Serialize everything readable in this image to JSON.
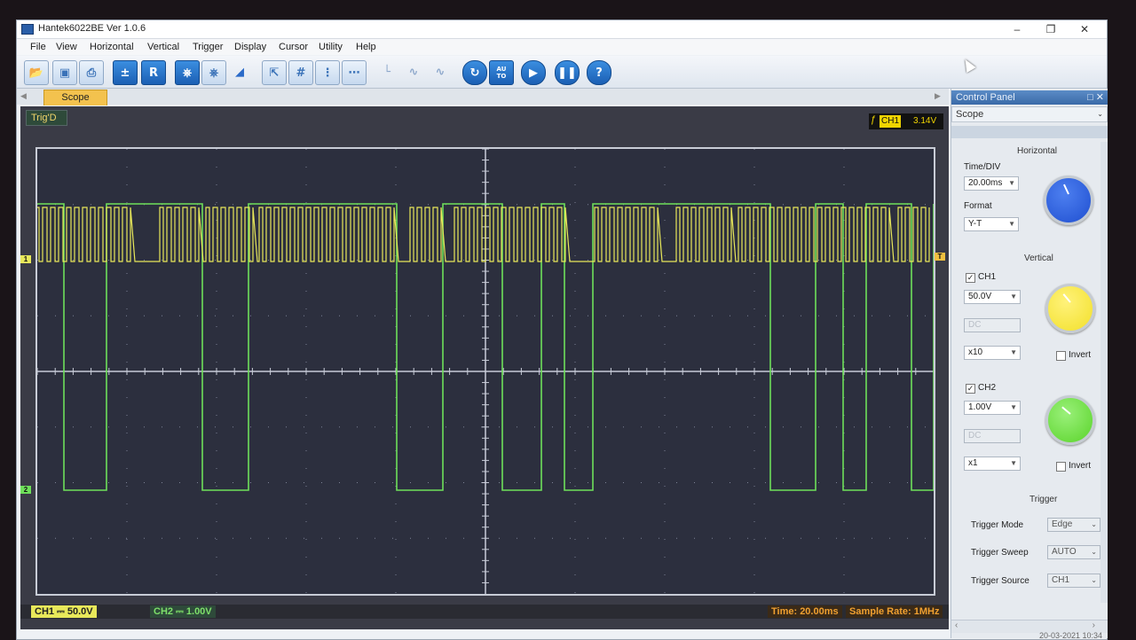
{
  "window": {
    "title": "Hantek6022BE Ver 1.0.6"
  },
  "menu": [
    "File",
    "View",
    "Horizontal",
    "Vertical",
    "Trigger",
    "Display",
    "Cursor",
    "Utility",
    "Help"
  ],
  "toolbar": {
    "r_label": "R",
    "auto_label": "AU\nTO",
    "help_label": "?"
  },
  "tab": {
    "label": "Scope"
  },
  "scope": {
    "trig_status": "Trig'D",
    "trig_channel": "CH1",
    "trig_level": "3.14V",
    "ch1_marker": "1",
    "ch2_marker": "2",
    "trig_marker": "T"
  },
  "status": {
    "ch1": "CH1 ⎓  50.0V",
    "ch2": "CH2 ⎓  1.00V",
    "time": "Time: 20.00ms",
    "rate": "Sample Rate: 1MHz"
  },
  "panel": {
    "title": "Control Panel",
    "mode": "Scope",
    "horizontal": {
      "section": "Horizontal",
      "timediv_label": "Time/DIV",
      "timediv": "20.00ms",
      "format_label": "Format",
      "format": "Y-T"
    },
    "vertical": {
      "section": "Vertical",
      "ch1_label": "CH1",
      "ch1_volts": "50.0V",
      "ch1_coupling": "DC",
      "ch1_probe": "x10",
      "ch1_invert": "Invert",
      "ch2_label": "CH2",
      "ch2_volts": "1.00V",
      "ch2_coupling": "DC",
      "ch2_probe": "x1",
      "ch2_invert": "Invert"
    },
    "trigger": {
      "section": "Trigger",
      "mode_label": "Trigger Mode",
      "mode": "Edge",
      "sweep_label": "Trigger Sweep",
      "sweep": "AUTO",
      "source_label": "Trigger Source",
      "source": "CH1"
    },
    "clock": "20-03-2021 10:34"
  },
  "colors": {
    "ch1": "#e8e85a",
    "ch2": "#6ee05a",
    "knob_time": "#1f4fd0",
    "knob_ch1": "#f2e02a",
    "knob_ch2": "#5ad42a"
  }
}
